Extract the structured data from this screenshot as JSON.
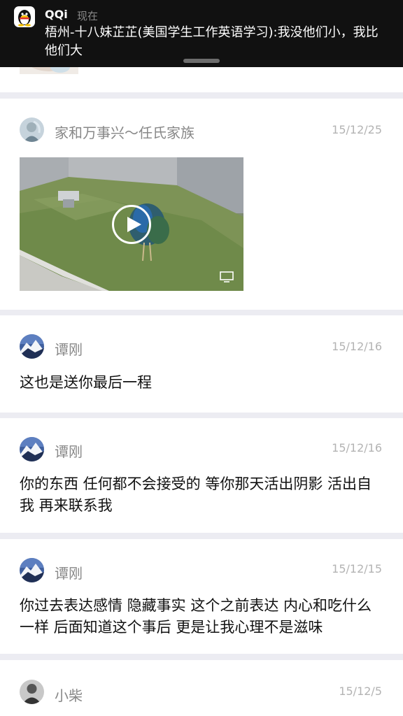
{
  "notification": {
    "app_name": "QQi",
    "time": "现在",
    "message": "梧州-十八妹芷芷(美国学生工作英语学习):我没他们小，我比他们大",
    "app_icon": "penguin-icon"
  },
  "posts": [
    {
      "username": "家和万事兴～任氏家族",
      "date": "15/12/25",
      "type": "video"
    },
    {
      "username": "谭刚",
      "date": "15/12/16",
      "text": "这也是送你最后一程"
    },
    {
      "username": "谭刚",
      "date": "15/12/16",
      "text": "你的东西 任何都不会接受的 等你那天活出阴影 活出自我 再来联系我"
    },
    {
      "username": "谭刚",
      "date": "15/12/15",
      "text": "你过去表达感情 隐藏事实 这个之前表达 内心和吃什么一样 后面知道这个事后 更是让我心理不是滋味"
    },
    {
      "username": "小柴",
      "date": "15/12/5"
    }
  ],
  "colors": {
    "background": "#ececf2",
    "card": "#ffffff",
    "text": "#111111",
    "username": "#888888",
    "date": "#b3b3b3",
    "notification_bg": "#111111"
  }
}
